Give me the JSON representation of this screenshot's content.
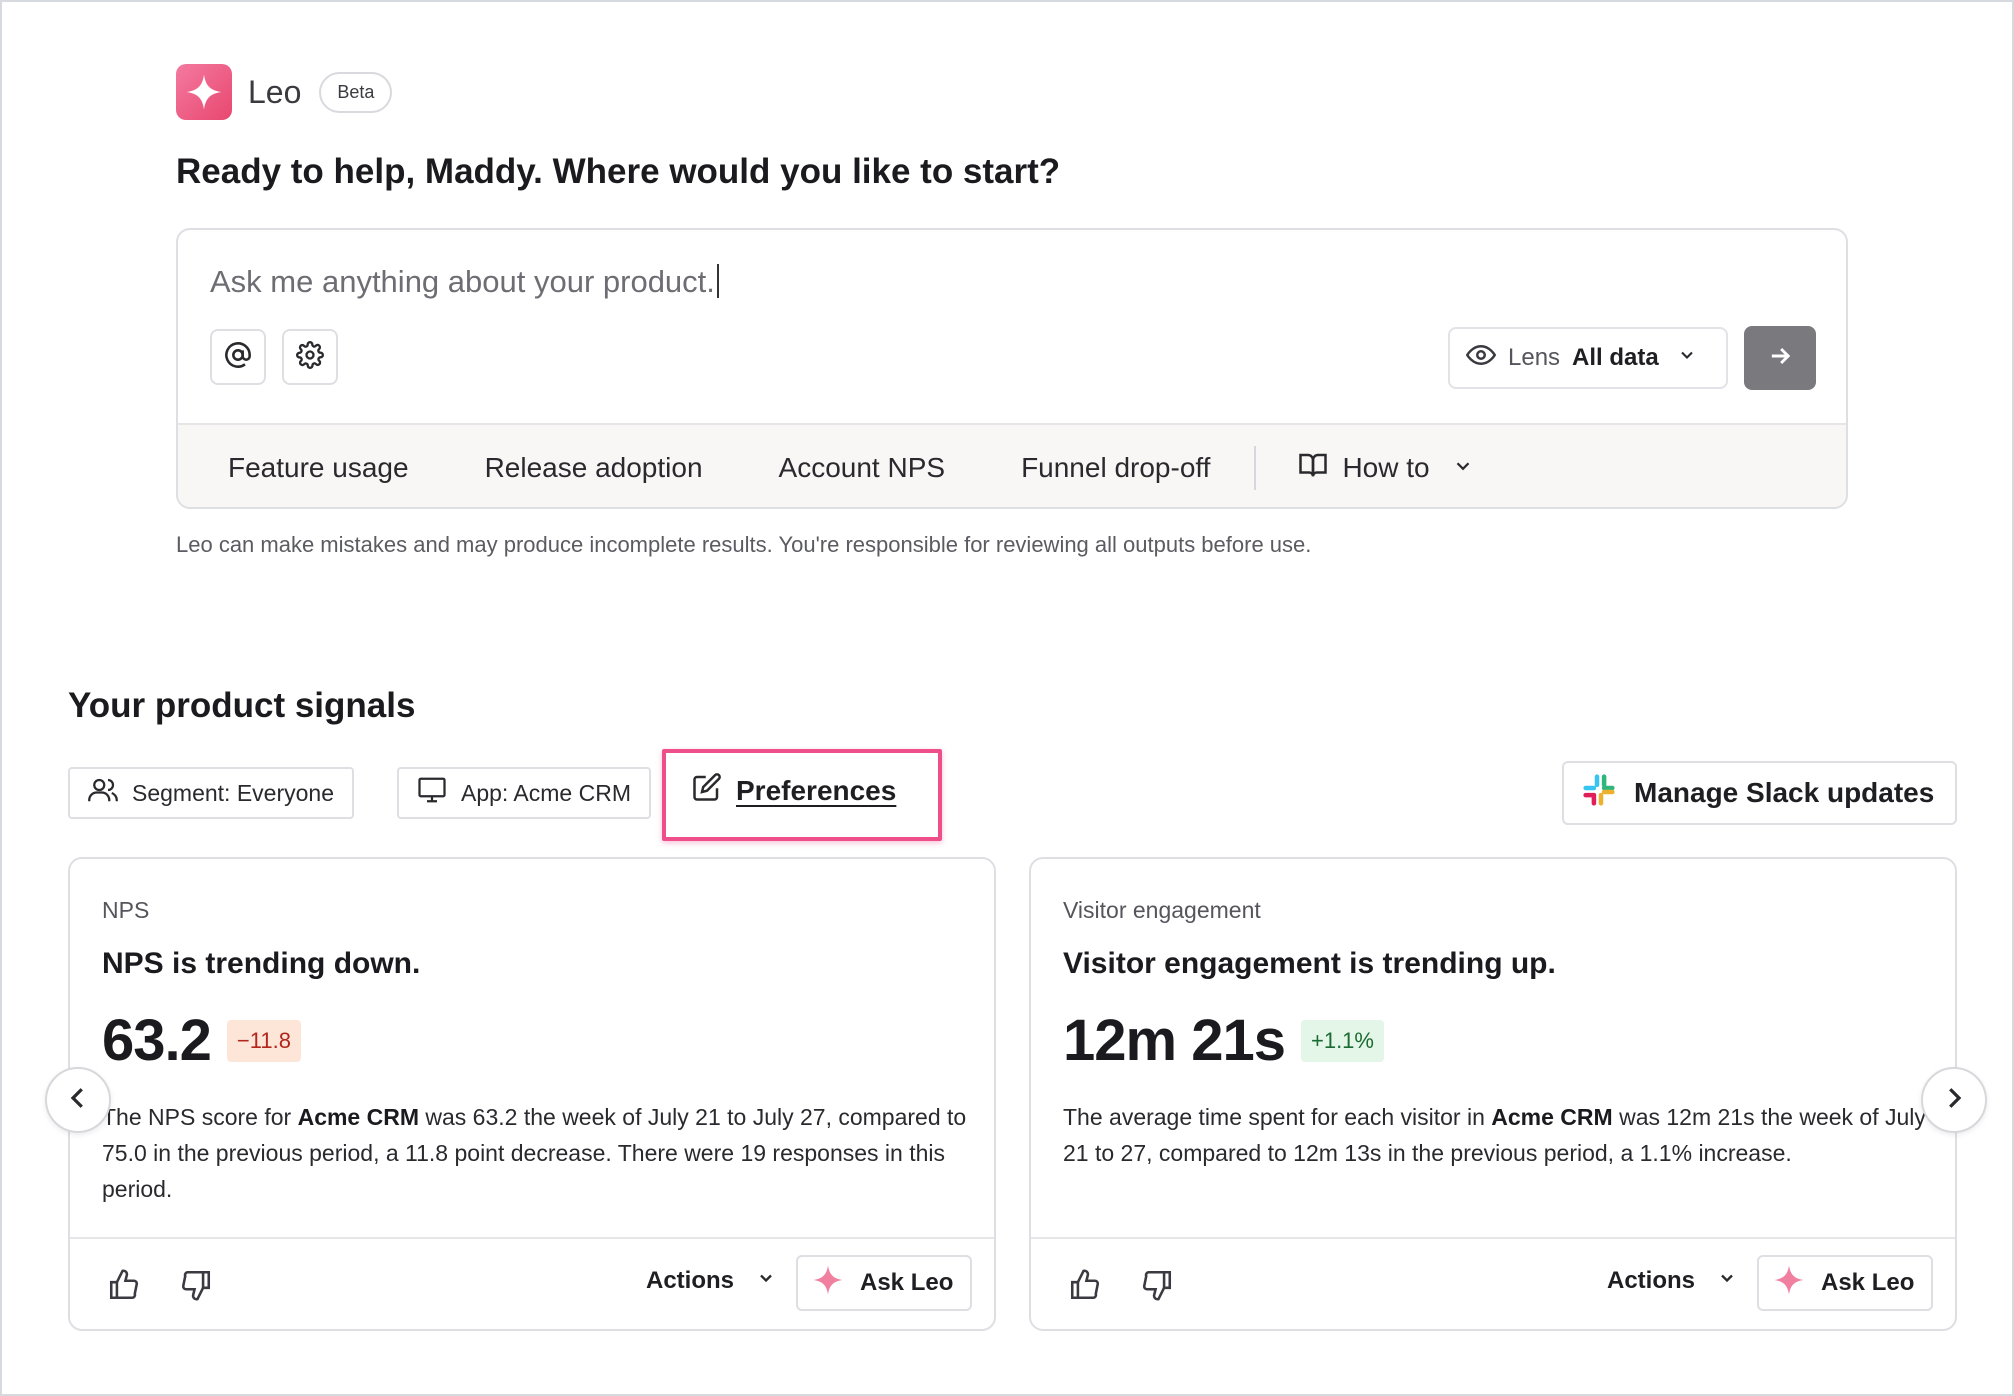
{
  "brand": {
    "name": "Leo",
    "badge": "Beta",
    "accent": "#e8476f",
    "icon": "sparkle-icon"
  },
  "greeting": "Ready to help, Maddy. Where would you like to start?",
  "prompt": {
    "placeholder": "Ask me anything about your product.",
    "mention_icon": "at-icon",
    "settings_icon": "gear-icon",
    "lens_label": "Lens",
    "lens_value": "All data",
    "send_icon": "arrow-right-icon",
    "suggestions": [
      "Feature usage",
      "Release adoption",
      "Account NPS",
      "Funnel drop-off"
    ],
    "howto_label": "How to"
  },
  "disclaimer": "Leo can make mistakes and may produce incomplete results. You're responsible for reviewing all outputs before use.",
  "signals": {
    "title": "Your product signals",
    "segment_filter": "Segment: Everyone",
    "app_filter": "App: Acme CRM",
    "preferences": "Preferences",
    "slack_button": "Manage Slack updates",
    "highlight_color": "#ee4f8b",
    "cards": [
      {
        "category": "NPS",
        "headline": "NPS is trending down.",
        "value": "63.2",
        "change": "−11.8",
        "trend": "down",
        "desc_pre": "The NPS score for ",
        "desc_bold": "Acme CRM",
        "desc_post": " was 63.2 the week of July 21 to July 27, compared to 75.0 in the previous period, a 11.8 point decrease. There were 19 responses in this period.",
        "actions_label": "Actions",
        "ask_label": "Ask Leo"
      },
      {
        "category": "Visitor engagement",
        "headline": "Visitor engagement is trending up.",
        "value": "12m 21s",
        "change": "+1.1%",
        "trend": "up",
        "desc_pre": "The average time spent for each visitor in ",
        "desc_bold": "Acme CRM",
        "desc_post": " was 12m 21s the week of July 21 to 27, compared to 12m 13s in the previous period, a 1.1% increase.",
        "actions_label": "Actions",
        "ask_label": "Ask Leo"
      }
    ]
  }
}
